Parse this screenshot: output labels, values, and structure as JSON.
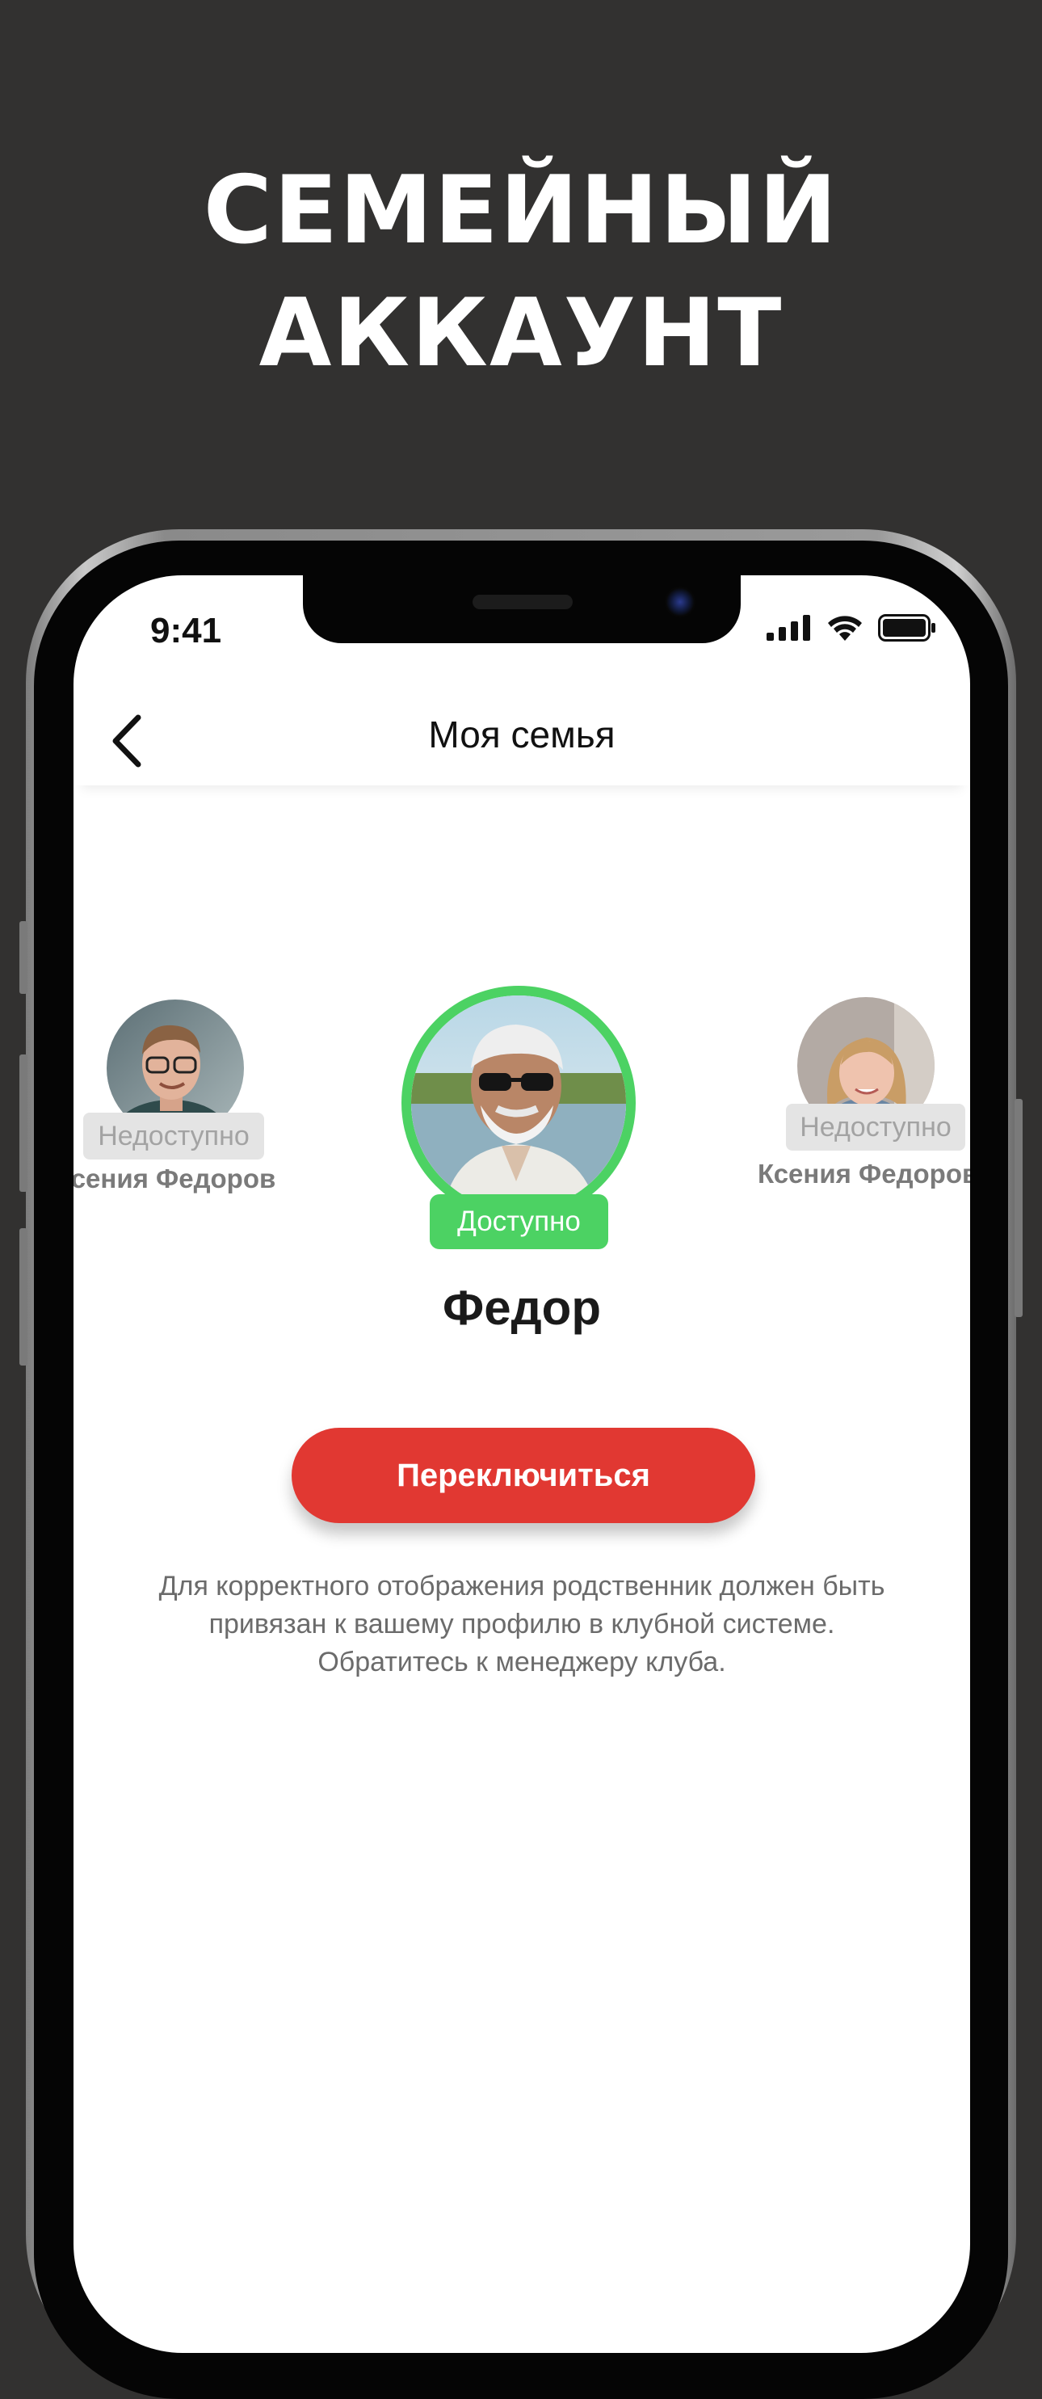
{
  "promo": {
    "headline_line1": "СЕМЕЙНЫЙ",
    "headline_line2": "АККАУНТ"
  },
  "status_bar": {
    "time": "9:41"
  },
  "header": {
    "title": "Моя семья"
  },
  "members": {
    "left": {
      "status": "Недоступно",
      "name": "Ксения Федоров"
    },
    "center": {
      "status": "Доступно",
      "name": "Федор"
    },
    "right": {
      "status": "Недоступно",
      "name": "Ксения Федоров"
    }
  },
  "actions": {
    "switch_label": "Переключиться"
  },
  "info": {
    "line1": "Для корректного отображения родственник должен быть",
    "line2": "привязан к вашему профилю в клубной системе.",
    "line3": "Обратитесь к менеджеру клуба."
  },
  "colors": {
    "background": "#323130",
    "accent_red": "#e13832",
    "available_green": "#4cd263",
    "unavailable_gray": "#e4e4e4"
  },
  "icons": [
    "back-chevron-icon",
    "cellular-signal-icon",
    "wifi-icon",
    "battery-icon"
  ]
}
